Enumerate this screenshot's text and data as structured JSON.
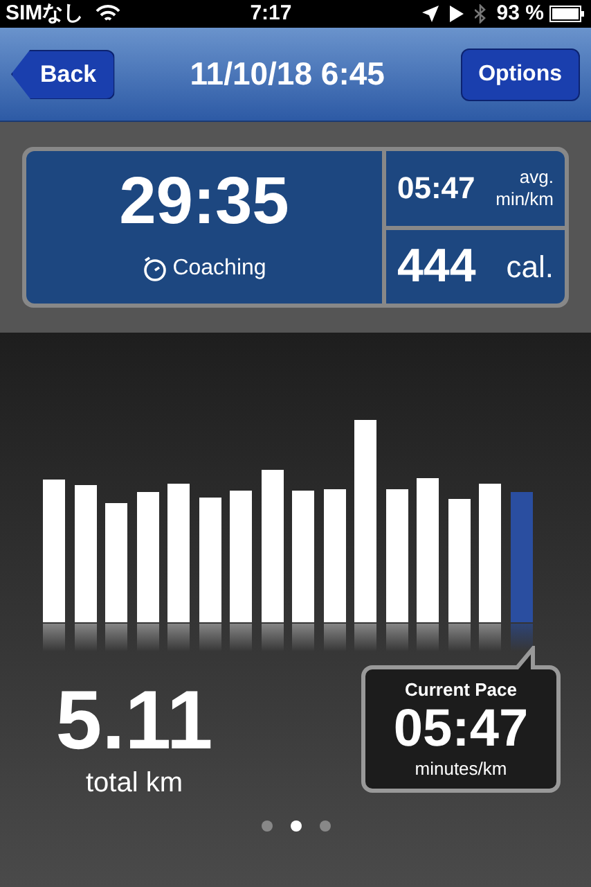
{
  "status_bar": {
    "carrier": "SIMなし",
    "time": "7:17",
    "battery": "93 %"
  },
  "nav": {
    "back": "Back",
    "title": "11/10/18 6:45",
    "options": "Options"
  },
  "summary": {
    "duration": "29:35",
    "coaching": "Coaching",
    "pace": "05:47",
    "pace_unit_1": "avg.",
    "pace_unit_2": "min/km",
    "calories": "444",
    "calories_unit": "cal."
  },
  "bars": [
    {
      "selected": false
    },
    {
      "selected": false
    },
    {
      "selected": false
    },
    {
      "selected": false
    },
    {
      "selected": false
    },
    {
      "selected": false
    },
    {
      "selected": false
    },
    {
      "selected": false
    },
    {
      "selected": false
    },
    {
      "selected": false
    },
    {
      "selected": false
    },
    {
      "selected": false
    },
    {
      "selected": false
    },
    {
      "selected": false
    },
    {
      "selected": false
    },
    {
      "selected": true
    }
  ],
  "distance": {
    "value": "5.11",
    "label": "total km"
  },
  "current_pace": {
    "title": "Current Pace",
    "value": "05:47",
    "unit": "minutes/km"
  },
  "page_dots": [
    {
      "selected": false
    },
    {
      "selected": true
    },
    {
      "selected": false
    }
  ]
}
